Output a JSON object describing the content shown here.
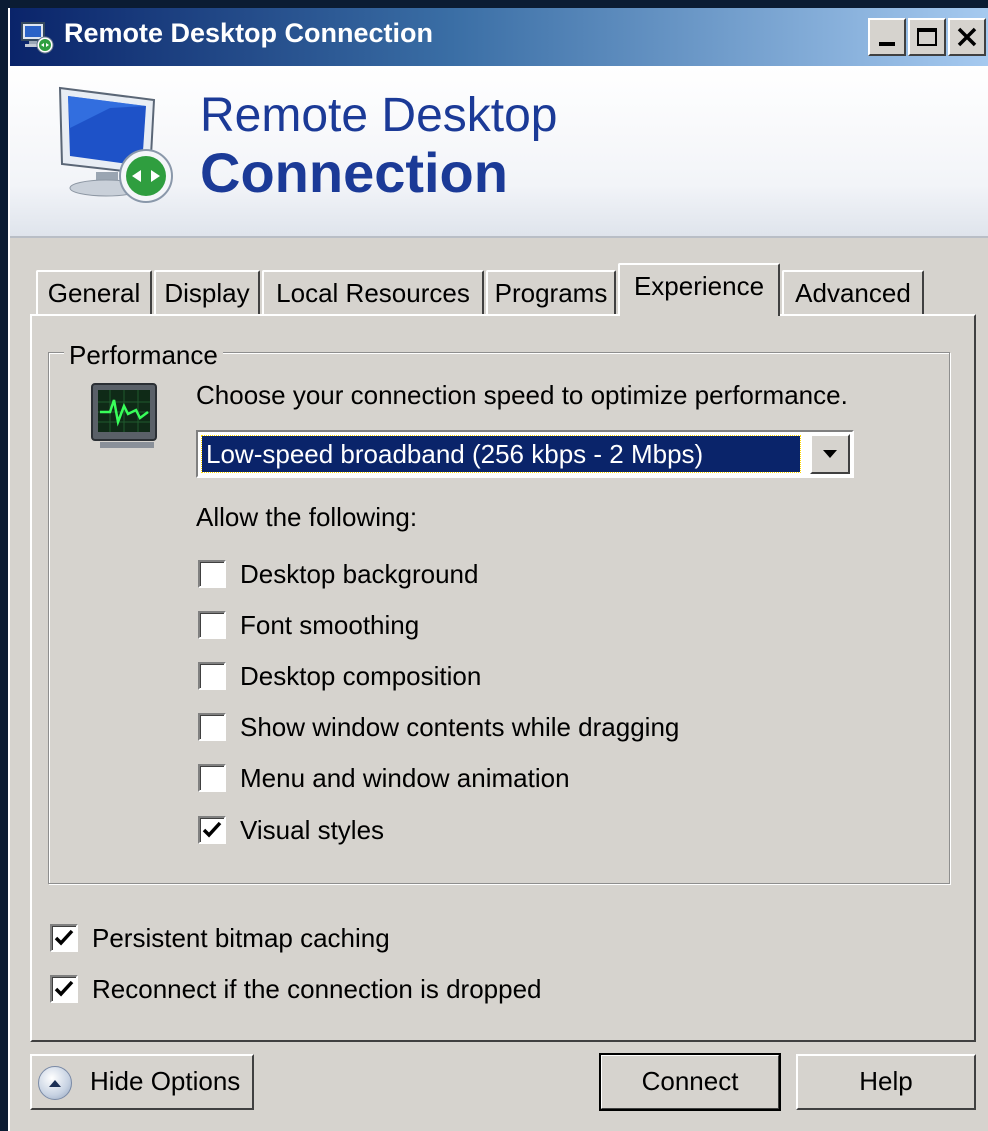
{
  "window": {
    "title": "Remote Desktop Connection",
    "minimize": "minimize",
    "maximize": "maximize",
    "close": "close"
  },
  "banner": {
    "line1": "Remote Desktop",
    "line2": "Connection"
  },
  "tabs": [
    {
      "label": "General",
      "active": false
    },
    {
      "label": "Display",
      "active": false
    },
    {
      "label": "Local Resources",
      "active": false
    },
    {
      "label": "Programs",
      "active": false
    },
    {
      "label": "Experience",
      "active": true
    },
    {
      "label": "Advanced",
      "active": false
    }
  ],
  "performance": {
    "group_label": "Performance",
    "instruction": "Choose your connection speed to optimize performance.",
    "speed_selected": "Low-speed broadband (256 kbps - 2 Mbps)",
    "allow_label": "Allow the following:",
    "options": [
      {
        "label": "Desktop background",
        "checked": false
      },
      {
        "label": "Font smoothing",
        "checked": false
      },
      {
        "label": "Desktop composition",
        "checked": false
      },
      {
        "label": "Show window contents while dragging",
        "checked": false
      },
      {
        "label": "Menu and window animation",
        "checked": false
      },
      {
        "label": "Visual styles",
        "checked": true
      }
    ]
  },
  "extras": [
    {
      "label": "Persistent bitmap caching",
      "checked": true
    },
    {
      "label": "Reconnect if the connection is dropped",
      "checked": true
    }
  ],
  "buttons": {
    "hide_options": "Hide Options",
    "connect": "Connect",
    "help": "Help"
  },
  "colors": {
    "titlebar_start": "#0a246a",
    "titlebar_end": "#a6caf0",
    "face": "#d6d3ce",
    "banner_text": "#1b3a97",
    "selection": "#0a246a"
  }
}
